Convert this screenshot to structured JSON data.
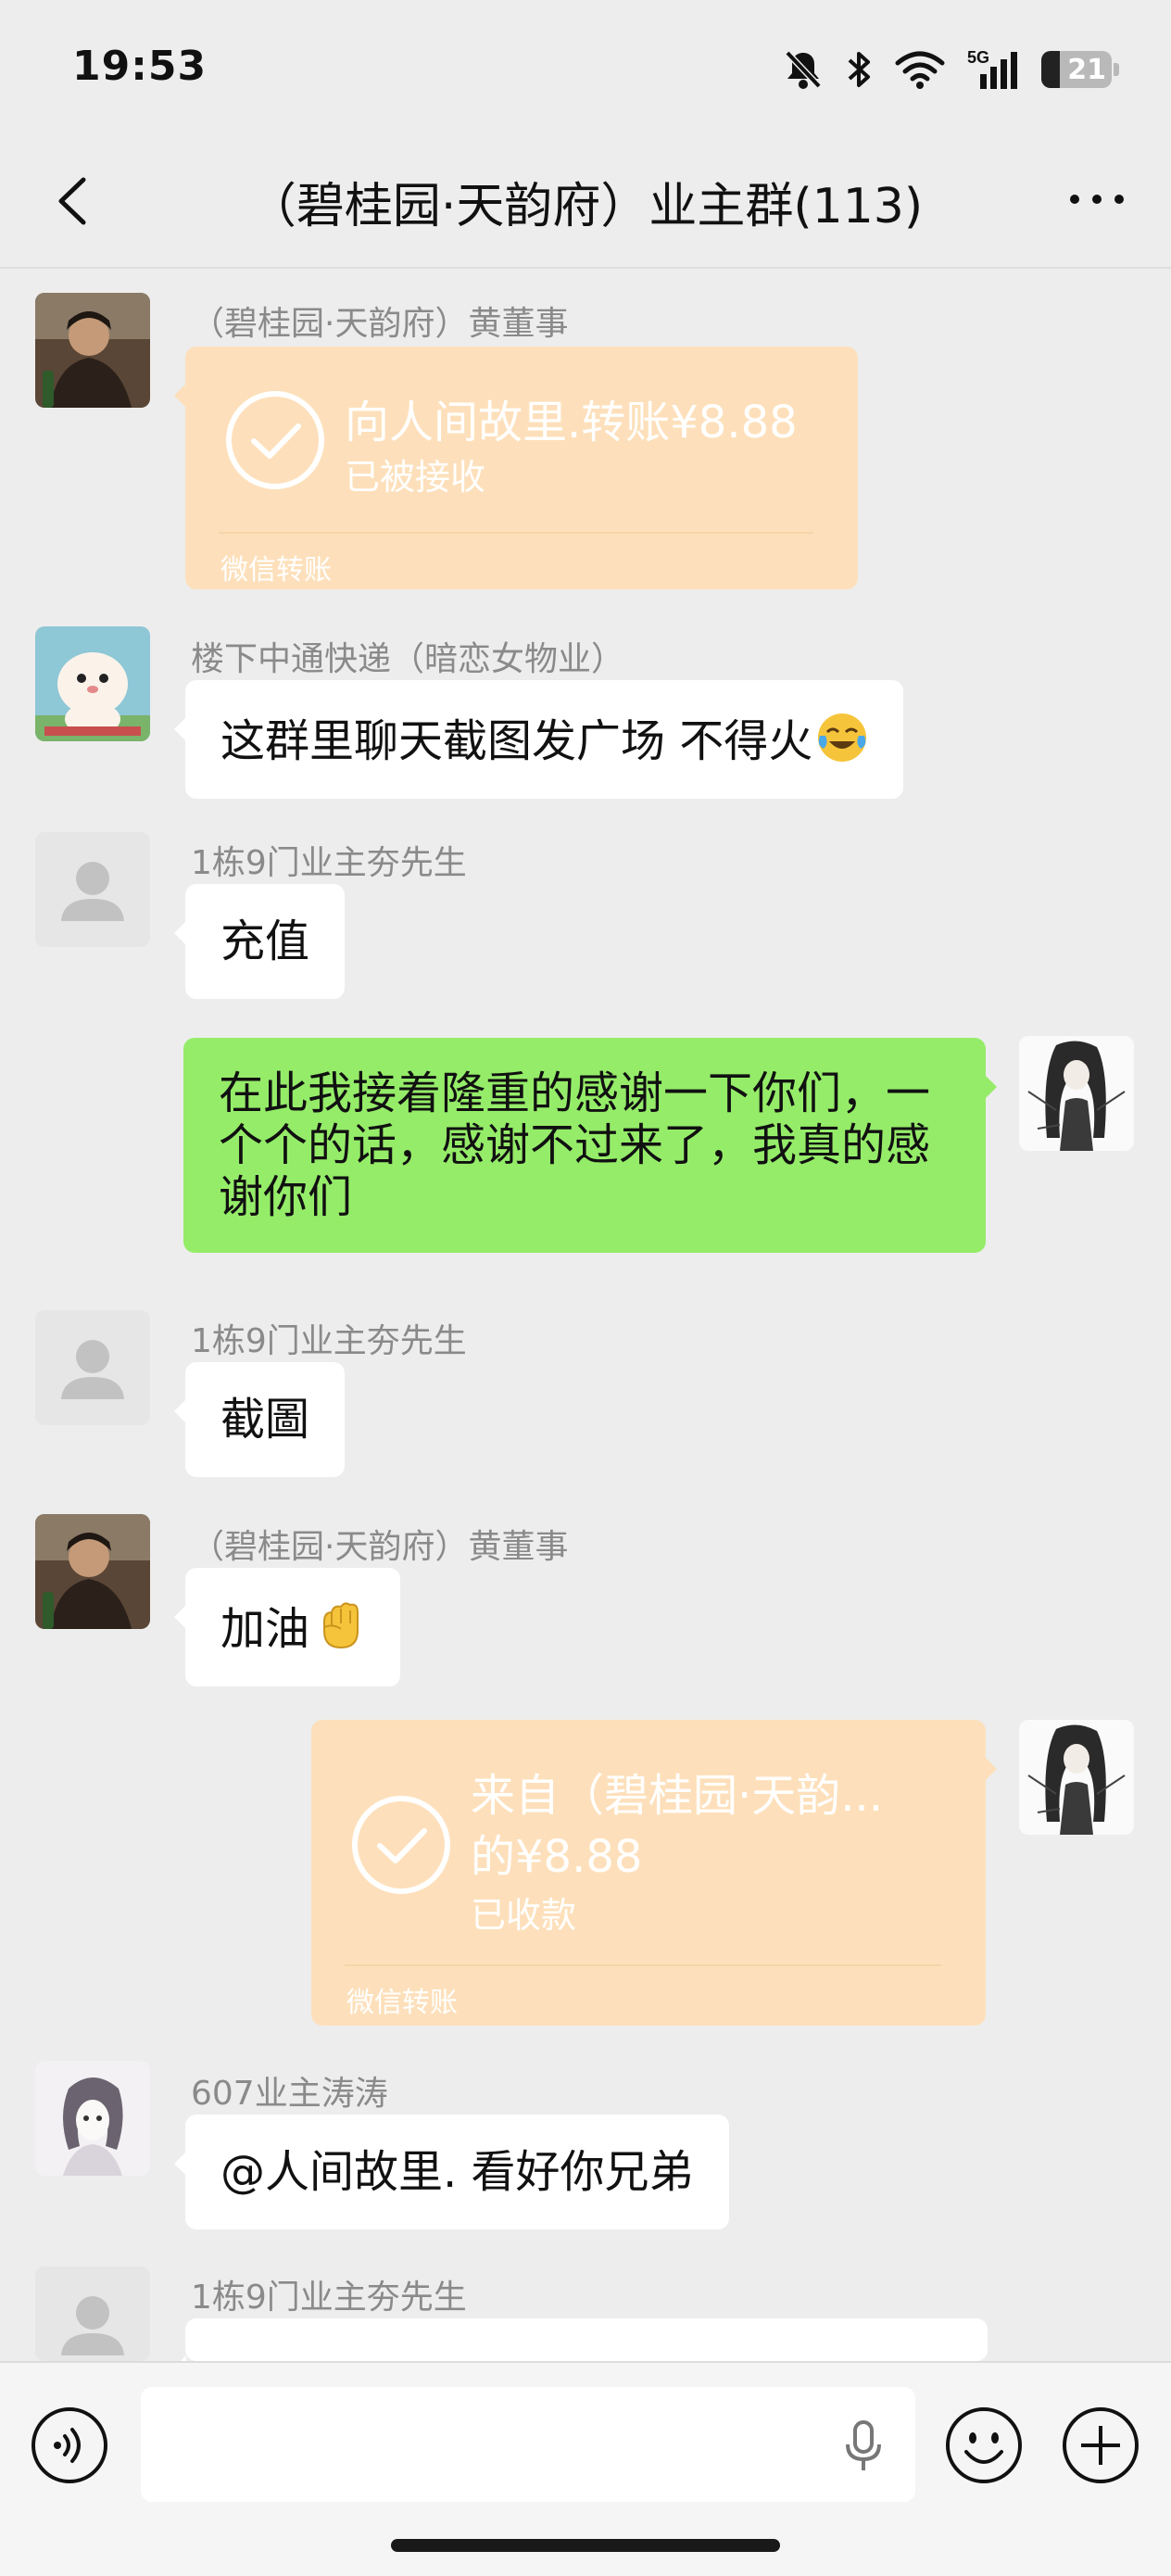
{
  "status": {
    "time": "19:53",
    "battery": "21",
    "network": "5G"
  },
  "nav": {
    "title": "（碧桂园·天韵府）业主群(113)"
  },
  "messages": [
    {
      "sender": "（碧桂园·天韵府）黄董事",
      "transfer": {
        "title": "向人间故里.转账¥8.88",
        "status": "已被接收",
        "footer": "微信转账"
      }
    },
    {
      "sender": "楼下中通快递（暗恋女物业）",
      "text": "这群里聊天截图发广场  不得火"
    },
    {
      "sender": "1栋9门业主夯先生",
      "text": "充值"
    },
    {
      "self": true,
      "text": "在此我接着隆重的感谢一下你们，一个个的话，感谢不过来了，我真的感谢你们"
    },
    {
      "sender": "1栋9门业主夯先生",
      "text": "截圖"
    },
    {
      "sender": "（碧桂园·天韵府）黄董事",
      "text": "加油"
    },
    {
      "self": true,
      "transfer": {
        "title_line1": "来自（碧桂园·天韵...",
        "title_line2": "的¥8.88",
        "status": "已收款",
        "footer": "微信转账"
      }
    },
    {
      "sender": "607业主涛涛",
      "text": "@人间故里. 看好你兄弟"
    },
    {
      "sender": "1栋9门业主夯先生"
    }
  ],
  "colors": {
    "self_bubble": "#95ec69",
    "transfer_card": "#fde0bb",
    "background": "#ededed"
  },
  "icons": [
    "back-arrow-icon",
    "more-icon",
    "voice-mode-icon",
    "microphone-icon",
    "emoji-icon",
    "plus-icon",
    "transfer-check-icon",
    "bell-off-icon",
    "bluetooth-icon",
    "wifi-icon",
    "signal-icon"
  ]
}
